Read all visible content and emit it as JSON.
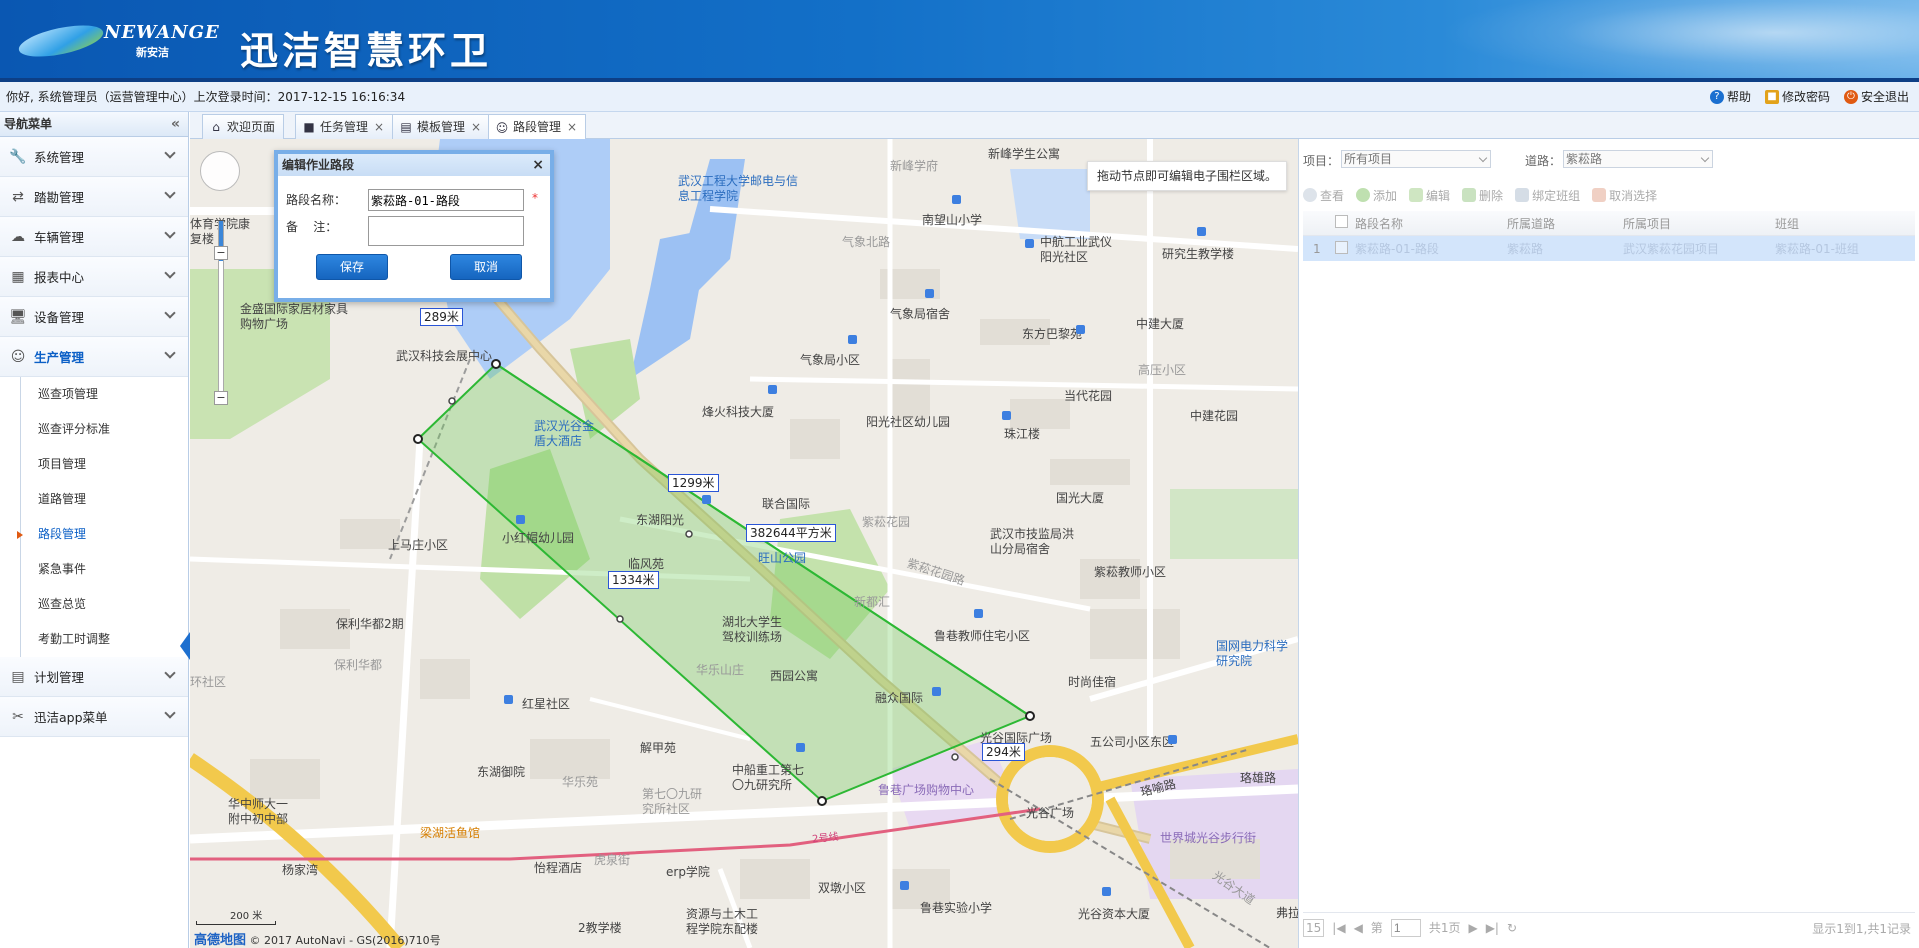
{
  "header": {
    "logo_brand": "NEWANGE",
    "logo_cn": "新安洁",
    "app_title": "迅洁智慧环卫"
  },
  "status": {
    "welcome": "你好, 系统管理员（运营管理中心）上次登录时间：2017-12-15 16:16:34",
    "links": [
      {
        "label": "帮助",
        "icon": "help-icon",
        "color": "#1a6fd0"
      },
      {
        "label": "修改密码",
        "icon": "lock-icon",
        "color": "#e2a21a"
      },
      {
        "label": "安全退出",
        "icon": "power-icon",
        "color": "#e05a12"
      }
    ]
  },
  "sidebar": {
    "title": "导航菜单",
    "groups": [
      {
        "label": "系统管理",
        "icon": "wrench-icon"
      },
      {
        "label": "踏勘管理",
        "icon": "arrows-icon"
      },
      {
        "label": "车辆管理",
        "icon": "cloud-icon"
      },
      {
        "label": "报表中心",
        "icon": "table-icon"
      },
      {
        "label": "设备管理",
        "icon": "monitor-icon"
      },
      {
        "label": "生产管理",
        "icon": "smile-icon"
      },
      {
        "label": "计划管理",
        "icon": "calendar-icon"
      },
      {
        "label": "迅洁app菜单",
        "icon": "tools-icon"
      }
    ],
    "sub_items": [
      "巡查项管理",
      "巡查评分标准",
      "项目管理",
      "道路管理",
      "路段管理",
      "紧急事件",
      "巡查总览",
      "考勤工时调整"
    ],
    "active_sub": "路段管理"
  },
  "tabs": [
    {
      "label": "欢迎页面",
      "icon": "home-icon",
      "closable": false
    },
    {
      "label": "任务管理",
      "icon": "task-icon",
      "closable": true
    },
    {
      "label": "模板管理",
      "icon": "template-icon",
      "closable": true
    },
    {
      "label": "路段管理",
      "icon": "smile-icon",
      "closable": true
    }
  ],
  "dialog": {
    "title": "编辑作业路段",
    "name_label": "路段名称：",
    "name_value": "紫菘路-01-路段",
    "required_mark": "*",
    "remark_label": "备    注：",
    "remark_value": "",
    "save_label": "保存",
    "cancel_label": "取消"
  },
  "map": {
    "hint": "拖动节点即可编辑电子围栏区域。",
    "measurements": {
      "edge_top": "289米",
      "edge_right": "1299米",
      "edge_left": "1334米",
      "edge_bottom": "294米",
      "area": "382644平方米"
    },
    "scale_label": "200 米",
    "amap_brand": "高德地图",
    "copyright": "© 2017 AutoNavi - GS(2016)710号",
    "labels": [
      {
        "t": "武汉工程大学邮电与信息工程学院",
        "c": "blue"
      },
      {
        "t": "新峰学府",
        "c": "muted"
      },
      {
        "t": "新峰学生公寓",
        "c": "dark"
      },
      {
        "t": "体育学院康复楼",
        "c": "dark"
      },
      {
        "t": "南望山小学",
        "c": "dark"
      },
      {
        "t": "中航工业武仪阳光社区",
        "c": "dark"
      },
      {
        "t": "研究生教学楼",
        "c": "dark"
      },
      {
        "t": "气象北路",
        "c": "muted"
      },
      {
        "t": "金盛国际家居材家具购物广场",
        "c": "dark"
      },
      {
        "t": "武汉科技会展中心",
        "c": "dark"
      },
      {
        "t": "气象局宿舍",
        "c": "dark"
      },
      {
        "t": "东方巴黎苑",
        "c": "dark"
      },
      {
        "t": "中建大厦",
        "c": "dark"
      },
      {
        "t": "气象局小区",
        "c": "dark"
      },
      {
        "t": "高压小区",
        "c": "muted"
      },
      {
        "t": "武汉光谷金盾大酒店",
        "c": "blue"
      },
      {
        "t": "烽火科技大厦",
        "c": "dark"
      },
      {
        "t": "当代花园",
        "c": "dark"
      },
      {
        "t": "中建花园",
        "c": "dark"
      },
      {
        "t": "阳光社区幼儿园",
        "c": "dark"
      },
      {
        "t": "珠江楼",
        "c": "dark"
      },
      {
        "t": "国光大厦",
        "c": "dark"
      },
      {
        "t": "联合国际",
        "c": "dark"
      },
      {
        "t": "上马庄小区",
        "c": "dark"
      },
      {
        "t": "小红帽幼儿园",
        "c": "dark"
      },
      {
        "t": "东湖阳光",
        "c": "dark"
      },
      {
        "t": "紫菘花园",
        "c": "muted"
      },
      {
        "t": "武汉市技监局洪山分局宿舍",
        "c": "dark"
      },
      {
        "t": "旺山公园",
        "c": "blue"
      },
      {
        "t": "紫菘教师小区",
        "c": "dark"
      },
      {
        "t": "临风苑",
        "c": "dark"
      },
      {
        "t": "紫菘花园路",
        "c": "muted"
      },
      {
        "t": "保利华都2期",
        "c": "dark"
      },
      {
        "t": "新都汇",
        "c": "muted"
      },
      {
        "t": "湖北大学生驾校训练场",
        "c": "dark"
      },
      {
        "t": "鲁巷教师住宅小区",
        "c": "dark"
      },
      {
        "t": "国网电力科学研究院",
        "c": "blue"
      },
      {
        "t": "保利华都",
        "c": "muted"
      },
      {
        "t": "华乐山庄",
        "c": "muted"
      },
      {
        "t": "西园公寓",
        "c": "dark"
      },
      {
        "t": "时尚佳宿",
        "c": "dark"
      },
      {
        "t": "红星社区",
        "c": "dark"
      },
      {
        "t": "融众国际",
        "c": "dark"
      },
      {
        "t": "光谷国际广场",
        "c": "dark"
      },
      {
        "t": "五公司小区东区",
        "c": "dark"
      },
      {
        "t": "解甲苑",
        "c": "dark"
      },
      {
        "t": "东湖御院",
        "c": "dark"
      },
      {
        "t": "华乐苑",
        "c": "muted"
      },
      {
        "t": "中船重工第七〇九研究所",
        "c": "dark"
      },
      {
        "t": "第七〇九研究所社区",
        "c": "muted"
      },
      {
        "t": "鲁巷广场购物中心",
        "c": "purple"
      },
      {
        "t": "光谷广场",
        "c": "dark"
      },
      {
        "t": "珞雄路",
        "c": "dark"
      },
      {
        "t": "珞喻路",
        "c": "dark"
      },
      {
        "t": "世界城光谷步行街",
        "c": "purple"
      },
      {
        "t": "华中师大一附中初中部",
        "c": "dark"
      },
      {
        "t": "梁湖活鱼馆",
        "c": "orange"
      },
      {
        "t": "2号线",
        "c": "pink"
      },
      {
        "t": "杨家湾",
        "c": "dark"
      },
      {
        "t": "怡程酒店",
        "c": "dark"
      },
      {
        "t": "虎泉街",
        "c": "muted"
      },
      {
        "t": "erp学院",
        "c": "dark"
      },
      {
        "t": "双墩小区",
        "c": "dark"
      },
      {
        "t": "鲁巷实验小学",
        "c": "dark"
      },
      {
        "t": "光谷资本大厦",
        "c": "dark"
      },
      {
        "t": "资源与土木工程学院东配楼",
        "c": "dark"
      },
      {
        "t": "2教学楼",
        "c": "dark"
      },
      {
        "t": "环社区",
        "c": "muted"
      },
      {
        "t": "光谷大道",
        "c": "muted"
      },
      {
        "t": "弗拉",
        "c": "dark"
      }
    ]
  },
  "right_panel": {
    "project_label": "项目：",
    "project_value": "所有项目",
    "road_label": "道路：",
    "road_value": "紫菘路",
    "toolbar": [
      {
        "label": "查看",
        "icon": "search-icon"
      },
      {
        "label": "添加",
        "icon": "add-icon"
      },
      {
        "label": "编辑",
        "icon": "edit-icon"
      },
      {
        "label": "删除",
        "icon": "delete-icon"
      },
      {
        "label": "绑定班组",
        "icon": "bind-icon"
      },
      {
        "label": "取消选择",
        "icon": "undo-icon"
      }
    ],
    "columns": [
      "路段名称",
      "所属道路",
      "所属项目",
      "班组"
    ],
    "rows": [
      {
        "num": "1",
        "cells": [
          "紫菘路-01-路段",
          "紫菘路",
          "武汉紫菘花园项目",
          "紫菘路-01-班组"
        ]
      }
    ],
    "pager": {
      "page_size": "15",
      "page_prefix": "第",
      "page_value": "1",
      "page_total": "共1页",
      "info": "显示1到1,共1记录"
    }
  }
}
